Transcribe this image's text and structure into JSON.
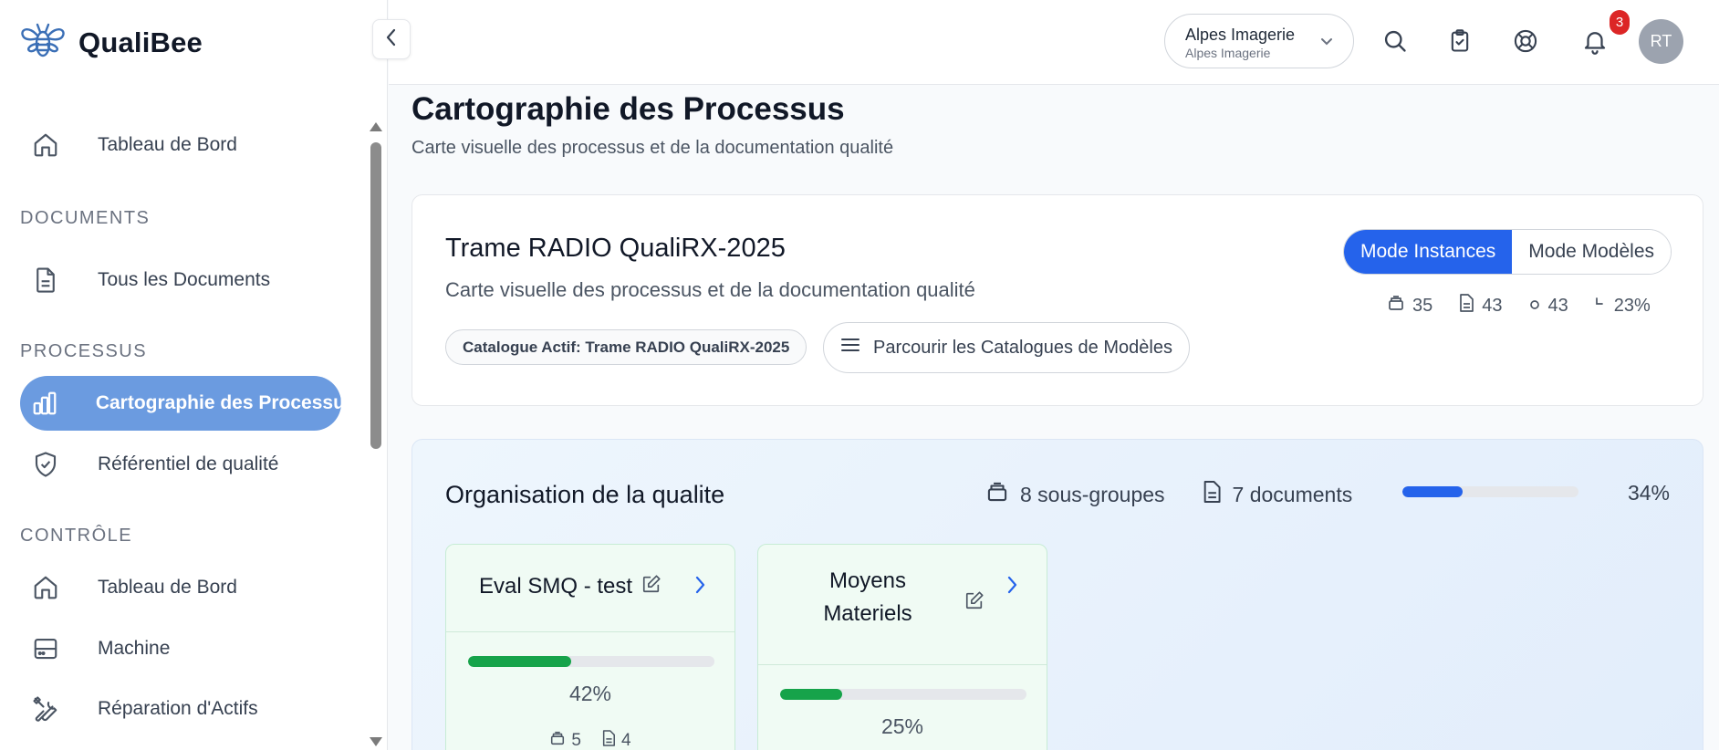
{
  "app": {
    "name": "QualiBee"
  },
  "sidebar": {
    "items": [
      {
        "label": "Tableau de Bord",
        "icon": "home-icon"
      },
      {
        "label": "Tous les Documents",
        "icon": "document-icon"
      },
      {
        "label": "Cartographie des Processus",
        "icon": "bar-chart-icon",
        "active": true
      },
      {
        "label": "Référentiel de qualité",
        "icon": "shield-check-icon"
      },
      {
        "label": "Tableau de Bord",
        "icon": "home-icon"
      },
      {
        "label": "Machine",
        "icon": "server-icon"
      },
      {
        "label": "Réparation d'Actifs",
        "icon": "tools-icon"
      }
    ],
    "sections": [
      "DOCUMENTS",
      "PROCESSUS",
      "CONTRÔLE"
    ]
  },
  "topbar": {
    "org_name": "Alpes Imagerie",
    "org_sub": "Alpes Imagerie",
    "notifications_count": "3",
    "avatar_initials": "RT"
  },
  "page": {
    "title": "Cartographie des Processus",
    "subtitle": "Carte visuelle des processus et de la documentation qualité"
  },
  "catalog": {
    "title": "Trame RADIO QualiRX-2025",
    "subtitle": "Carte visuelle des processus et de la documentation qualité",
    "active_pill": "Catalogue Actif: Trame RADIO QualiRX-2025",
    "browse_label": "Parcourir les Catalogues de Modèles",
    "mode_instances": "Mode Instances",
    "mode_models": "Mode Modèles",
    "stats": {
      "groups": "35",
      "documents": "43",
      "items": "43",
      "completion": "23%"
    }
  },
  "group": {
    "title": "Organisation de la qualite",
    "subgroups": "8 sous-groupes",
    "documents": "7 documents",
    "progress": 34,
    "progress_label": "34%",
    "cards": [
      {
        "name": "Eval SMQ - test",
        "progress": 42,
        "progress_label": "42%",
        "groups": "5",
        "docs": "4"
      },
      {
        "name": "Moyens Materiels",
        "progress": 25,
        "progress_label": "25%"
      }
    ]
  },
  "colors": {
    "primary": "#2563eb",
    "active_nav": "#6b9be0",
    "success": "#16a34a",
    "danger": "#dc2626"
  }
}
